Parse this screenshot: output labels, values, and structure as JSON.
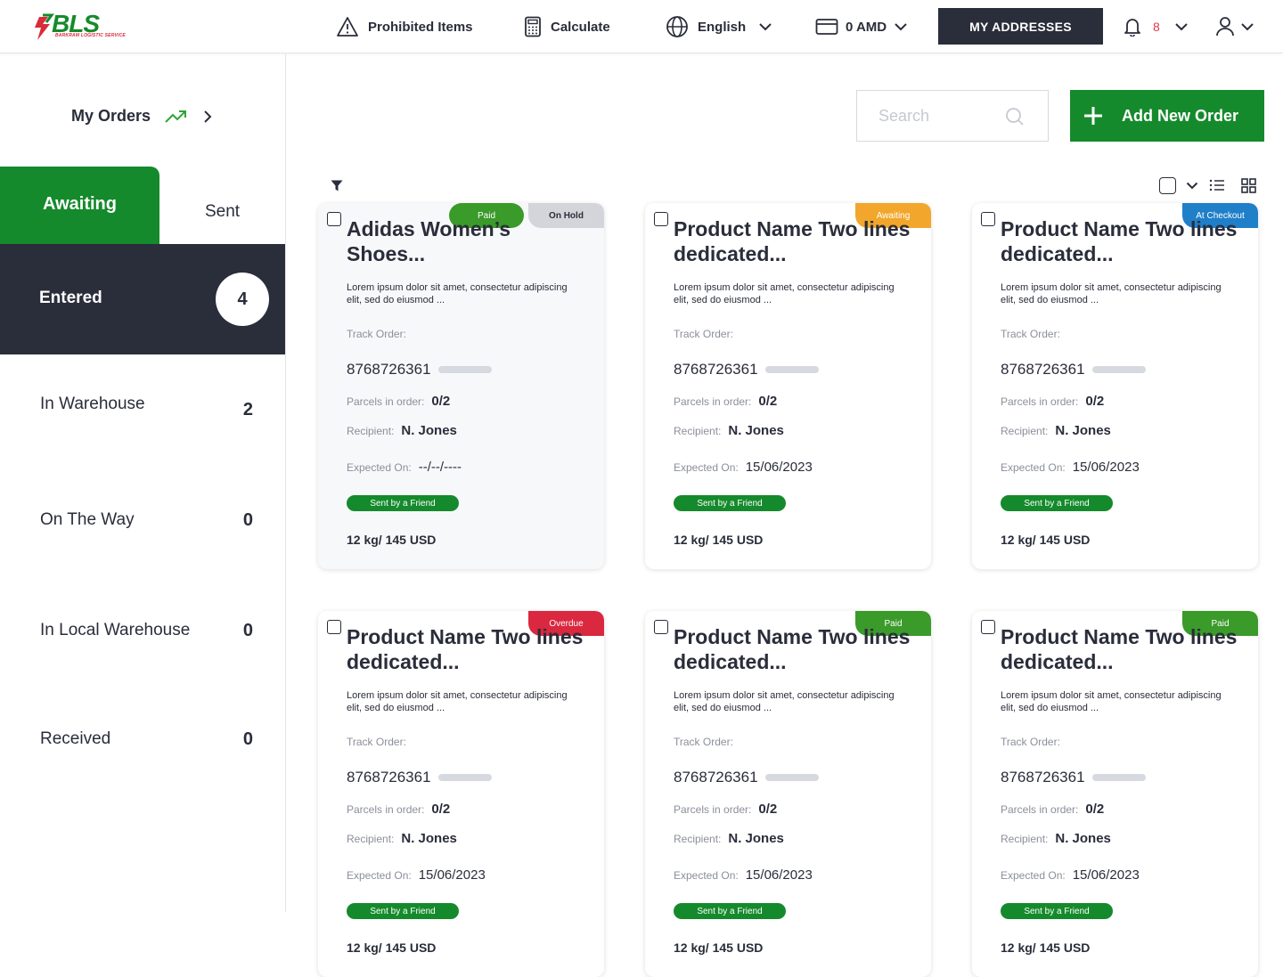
{
  "header": {
    "logo_text": "BLS",
    "logo_sub": "BARKRAM LOGISTIC SERVICE",
    "prohibited_label": "Prohibited Items",
    "calculate_label": "Calculate",
    "language_label": "English",
    "balance_label": "0 AMD",
    "addresses_label": "MY ADDRESSES",
    "notification_count": "8"
  },
  "sidebar": {
    "my_orders_label": "My Orders",
    "tab_awaiting": "Awaiting",
    "tab_sent": "Sent",
    "entered_label": "Entered",
    "entered_count": "4",
    "statuses": [
      {
        "label": "In Warehouse",
        "count": "2"
      },
      {
        "label": "On The Way",
        "count": "0"
      },
      {
        "label": "In Local Warehouse",
        "count": "0"
      },
      {
        "label": "Received",
        "count": "0"
      }
    ]
  },
  "main": {
    "search_placeholder": "Search",
    "add_order_label": "Add New Order"
  },
  "card_labels": {
    "track": "Track Order:",
    "parcels": "Parcels in order:",
    "recipient": "Recipient:",
    "expected": "Expected On:"
  },
  "cards": [
    {
      "title": "Adidas Women’s Shoes...",
      "desc": "Lorem ipsum dolor sit amet, consectetur adipiscing elit, sed do eiusmod ...",
      "badges": [
        {
          "text": "Paid",
          "color": "#3a9a2a"
        },
        {
          "text": "On Hold",
          "color": "#d3d5da"
        }
      ],
      "track": "8768726361",
      "parcels": "0/2",
      "recipient": "N. Jones",
      "expected": "--/--/----",
      "friend": "Sent by a Friend",
      "weight": "12 kg/ 145 USD"
    },
    {
      "title": "Product Name Two lines dedicated...",
      "desc": "Lorem ipsum dolor sit amet, consectetur adipiscing elit, sed do eiusmod ...",
      "badges": [
        {
          "text": "Awaiting",
          "color": "#f2a72c"
        }
      ],
      "track": "8768726361",
      "parcels": "0/2",
      "recipient": "N. Jones",
      "expected": "15/06/2023",
      "friend": "Sent by a Friend",
      "weight": "12 kg/ 145 USD"
    },
    {
      "title": "Product Name Two lines dedicated...",
      "desc": "Lorem ipsum dolor sit amet, consectetur adipiscing elit, sed do eiusmod ...",
      "badges": [
        {
          "text": "At Checkout",
          "color": "#1f7fc9"
        }
      ],
      "track": "8768726361",
      "parcels": "0/2",
      "recipient": "N. Jones",
      "expected": "15/06/2023",
      "friend": "Sent by a Friend",
      "weight": "12 kg/ 145 USD"
    },
    {
      "title": "Product Name Two lines dedicated...",
      "desc": "Lorem ipsum dolor sit amet, consectetur adipiscing elit, sed do eiusmod ...",
      "badges": [
        {
          "text": "Overdue",
          "color": "#d9283f"
        }
      ],
      "track": "8768726361",
      "parcels": "0/2",
      "recipient": "N. Jones",
      "expected": "15/06/2023",
      "friend": "Sent by a Friend",
      "weight": "12 kg/ 145 USD"
    },
    {
      "title": "Product Name Two lines dedicated...",
      "desc": "Lorem ipsum dolor sit amet, consectetur adipiscing elit, sed do eiusmod ...",
      "badges": [
        {
          "text": "Paid",
          "color": "#3a9a2a"
        }
      ],
      "track": "8768726361",
      "parcels": "0/2",
      "recipient": "N. Jones",
      "expected": "15/06/2023",
      "friend": "Sent by a Friend",
      "weight": "12 kg/ 145 USD"
    },
    {
      "title": "Product Name Two lines dedicated...",
      "desc": "Lorem ipsum dolor sit amet, consectetur adipiscing elit, sed do eiusmod ...",
      "badges": [
        {
          "text": "Paid",
          "color": "#3a9a2a"
        }
      ],
      "track": "8768726361",
      "parcels": "0/2",
      "recipient": "N. Jones",
      "expected": "15/06/2023",
      "friend": "Sent by a Friend",
      "weight": "12 kg/ 145 USD"
    }
  ],
  "colors": {
    "brand_green": "#158a2c",
    "dark": "#2a2d3a",
    "alert_red": "#e03a4a"
  },
  "icons": [
    "warning-icon",
    "calculator-icon",
    "globe-icon",
    "card-icon",
    "bell-icon",
    "user-icon",
    "trend-up-icon",
    "filter-icon",
    "list-view-icon",
    "grid-view-icon",
    "search-icon",
    "plus-icon"
  ]
}
